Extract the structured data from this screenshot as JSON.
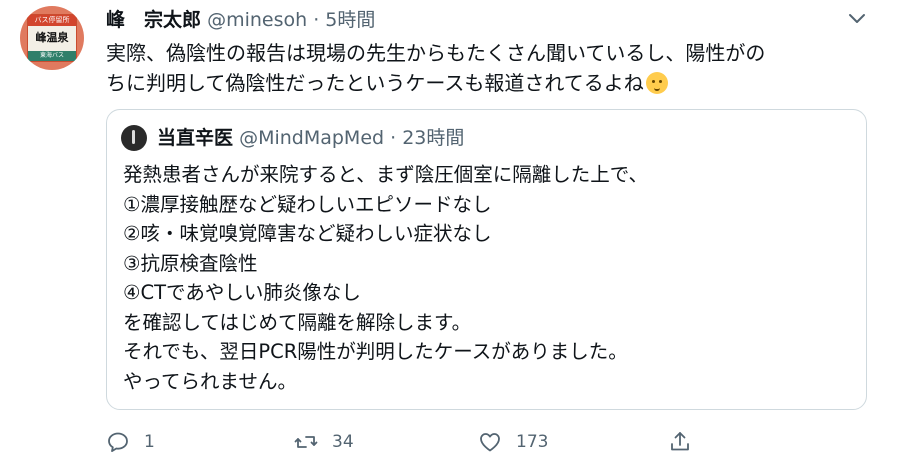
{
  "tweet": {
    "display_name": "峰　宗太郎",
    "handle": "@minesoh",
    "separator": "·",
    "time": "5時間",
    "text_line1": "実際、偽陰性の報告は現場の先生からもたくさん聞いているし、陽性がの",
    "text_line2": "ちに判明して偽陰性だったというケースも報道されてるよね",
    "emoji": "hugging-face-emoji"
  },
  "avatar": {
    "sign_top": "バス停留所",
    "sign_main": "峰温泉",
    "sign_bottom": "東海バス"
  },
  "quote": {
    "display_name": "当直辛医",
    "handle": "@MindMapMed",
    "separator": "·",
    "time": "23時間",
    "lines": [
      "発熱患者さんが来院すると、まず陰圧個室に隔離した上で、",
      "①濃厚接触歴など疑わしいエピソードなし",
      "②咳・味覚嗅覚障害など疑わしい症状なし",
      "③抗原検査陰性",
      "④CTであやしい肺炎像なし",
      "を確認してはじめて隔離を解除します。",
      "それでも、翌日PCR陽性が判明したケースがありました。",
      "やってられません。"
    ]
  },
  "actions": {
    "reply_count": "1",
    "retweet_count": "34",
    "like_count": "173"
  },
  "colors": {
    "text": "#0f1419",
    "secondary": "#536471",
    "border": "#cfd9de"
  }
}
